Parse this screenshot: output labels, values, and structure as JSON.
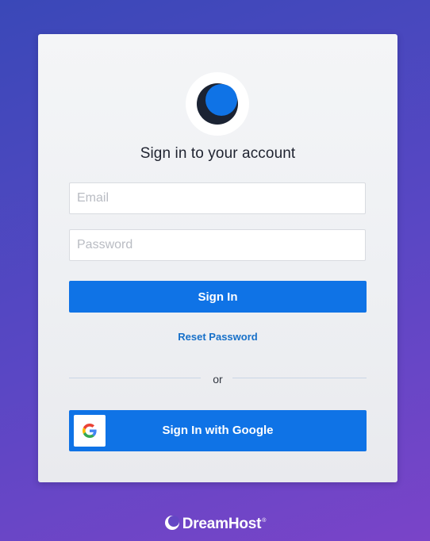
{
  "login": {
    "logo_icon": "dreamhost-moon-icon",
    "title": "Sign in to your account",
    "email_placeholder": "Email",
    "password_placeholder": "Password",
    "sign_in_label": "Sign In",
    "reset_password_label": "Reset Password",
    "divider_text": "or",
    "google_label": "Sign In with Google",
    "google_icon": "google-g-icon"
  },
  "footer": {
    "brand_name": "DreamHost",
    "trademark": "®",
    "brand_icon": "dreamhost-moon-icon"
  },
  "colors": {
    "background_start": "#3a48b8",
    "background_end": "#7a44c8",
    "primary_button": "#0f73e6",
    "link": "#1770c9",
    "card": "#f1f2f5"
  }
}
